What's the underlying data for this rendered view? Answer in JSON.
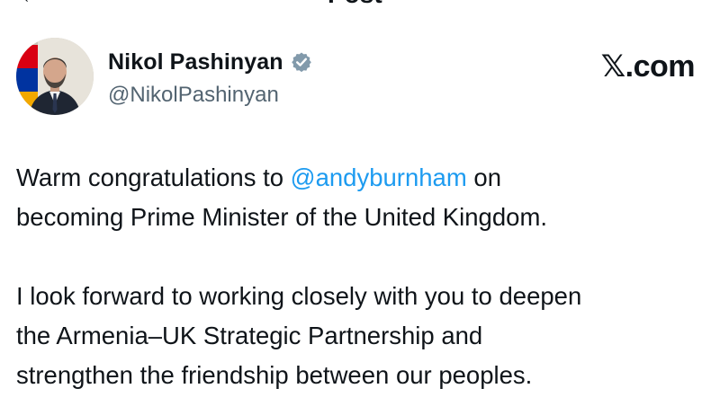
{
  "header": {
    "title": "Post"
  },
  "author": {
    "display_name": "Nikol Pashinyan",
    "handle": "@NikolPashinyan",
    "verified": true,
    "avatar_icon": "avatar-portrait"
  },
  "brand": {
    "label_mark": "𝕏",
    "label_suffix": ".com"
  },
  "tweet": {
    "line1_prefix": "Warm congratulations to ",
    "line1_mention": "@andyburnham",
    "line1_suffix": " on",
    "line2": "becoming Prime Minister of the United Kingdom.",
    "line3": "I look forward to working closely with you to deepen",
    "line4": "the Armenia–UK Strategic Partnership and",
    "line5": "strengthen the friendship between our peoples."
  },
  "colors": {
    "mention": "#1d9bf0",
    "secondary_text": "#536471",
    "verified_badge": "#829aab",
    "flag_red": "#d90012",
    "flag_blue": "#0033a0",
    "flag_orange": "#f2a800"
  }
}
